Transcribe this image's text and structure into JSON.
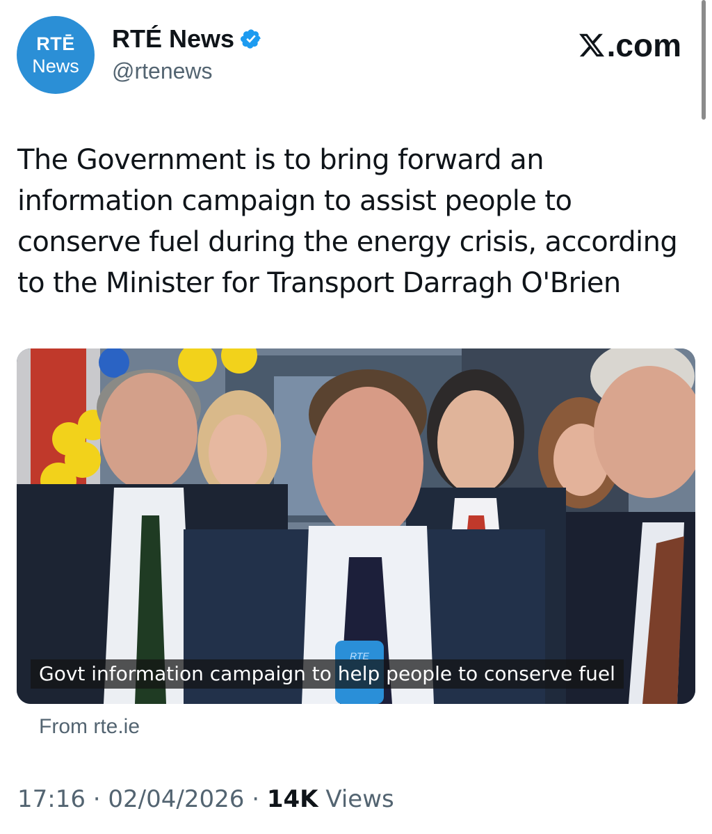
{
  "avatar": {
    "line1": "RTĒ",
    "line2": "News",
    "color": "#2b8fd6"
  },
  "account": {
    "display_name": "RTÉ News",
    "handle": "@rtenews",
    "verified_color": "#1d9bf0"
  },
  "branding": {
    "site_suffix": ".com"
  },
  "tweet": {
    "text": "The Government is to bring forward an information campaign to assist people to conserve fuel during the energy crisis, according to the Minister for Transport Darragh O'Brien"
  },
  "media": {
    "caption": "Govt information campaign to help people to conserve fuel",
    "mic_label": "RTE"
  },
  "link_source": "From rte.ie",
  "meta": {
    "time": "17:16",
    "date": "02/04/2026",
    "views_count": "14K",
    "views_label": "Views",
    "separator": "·"
  }
}
